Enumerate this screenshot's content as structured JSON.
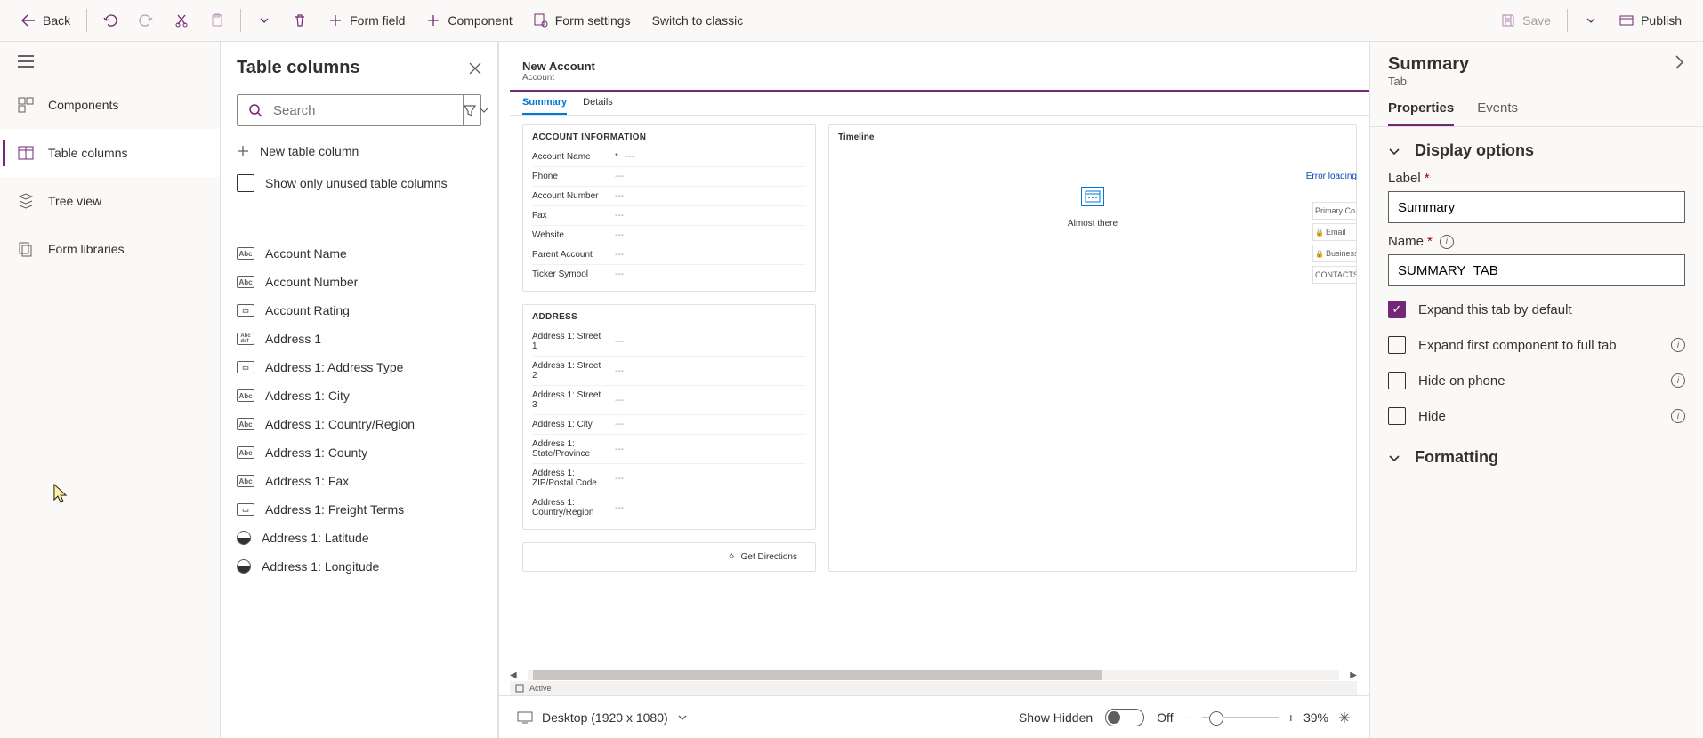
{
  "cmdbar": {
    "back": "Back",
    "form_field": "Form field",
    "component": "Component",
    "form_settings": "Form settings",
    "switch_classic": "Switch to classic",
    "save": "Save",
    "publish": "Publish"
  },
  "rail": {
    "items": [
      {
        "label": "Components"
      },
      {
        "label": "Table columns"
      },
      {
        "label": "Tree view"
      },
      {
        "label": "Form libraries"
      }
    ]
  },
  "tc": {
    "title": "Table columns",
    "search_placeholder": "Search",
    "new_label": "New table column",
    "unused_label": "Show only unused table columns",
    "items": [
      {
        "type": "abc",
        "label": "Account Name"
      },
      {
        "type": "abc",
        "label": "Account Number"
      },
      {
        "type": "opt",
        "label": "Account Rating"
      },
      {
        "type": "def",
        "label": "Address 1"
      },
      {
        "type": "opt",
        "label": "Address 1: Address Type"
      },
      {
        "type": "abc",
        "label": "Address 1: City"
      },
      {
        "type": "abc",
        "label": "Address 1: Country/Region"
      },
      {
        "type": "abc",
        "label": "Address 1: County"
      },
      {
        "type": "abc",
        "label": "Address 1: Fax"
      },
      {
        "type": "opt",
        "label": "Address 1: Freight Terms"
      },
      {
        "type": "ll",
        "label": "Address 1: Latitude"
      },
      {
        "type": "ll",
        "label": "Address 1: Longitude"
      }
    ]
  },
  "canvas": {
    "title": "New Account",
    "subtitle": "Account",
    "error_link": "Error loading",
    "tabs": [
      {
        "label": "Summary",
        "active": true
      },
      {
        "label": "Details",
        "active": false
      }
    ],
    "sections": {
      "account_info": {
        "title": "ACCOUNT INFORMATION",
        "fields": [
          {
            "label": "Account Name",
            "required": true,
            "value": "---"
          },
          {
            "label": "Phone",
            "value": "---"
          },
          {
            "label": "Account Number",
            "value": "---"
          },
          {
            "label": "Fax",
            "value": "---"
          },
          {
            "label": "Website",
            "value": "---"
          },
          {
            "label": "Parent Account",
            "value": "---"
          },
          {
            "label": "Ticker Symbol",
            "value": "---"
          }
        ]
      },
      "address": {
        "title": "ADDRESS",
        "fields": [
          {
            "label": "Address 1: Street 1",
            "value": "---"
          },
          {
            "label": "Address 1: Street 2",
            "value": "---"
          },
          {
            "label": "Address 1: Street 3",
            "value": "---"
          },
          {
            "label": "Address 1: City",
            "value": "---"
          },
          {
            "label": "Address 1: State/Province",
            "value": "---"
          },
          {
            "label": "Address 1: ZIP/Postal Code",
            "value": "---"
          },
          {
            "label": "Address 1: Country/Region",
            "value": "---"
          }
        ],
        "get_directions": "Get Directions"
      },
      "timeline": {
        "title": "Timeline",
        "status": "Almost there"
      }
    },
    "strip": [
      {
        "label": "Primary Co"
      },
      {
        "label": "Email",
        "lock": true
      },
      {
        "label": "Business",
        "lock": true
      },
      {
        "label": "CONTACTS"
      }
    ],
    "status_row": "Active",
    "footer": {
      "device": "Desktop (1920 x 1080)",
      "show_hidden": "Show Hidden",
      "toggle": "Off",
      "zoom": "39%"
    }
  },
  "props": {
    "title": "Summary",
    "subtitle": "Tab",
    "tabs": [
      {
        "label": "Properties",
        "active": true
      },
      {
        "label": "Events",
        "active": false
      }
    ],
    "accordion1": "Display options",
    "label_lbl": "Label",
    "label_val": "Summary",
    "name_lbl": "Name",
    "name_val": "SUMMARY_TAB",
    "chk_expand": "Expand this tab by default",
    "chk_expand_first": "Expand first component to full tab",
    "chk_hide_phone": "Hide on phone",
    "chk_hide": "Hide",
    "accordion2": "Formatting"
  }
}
